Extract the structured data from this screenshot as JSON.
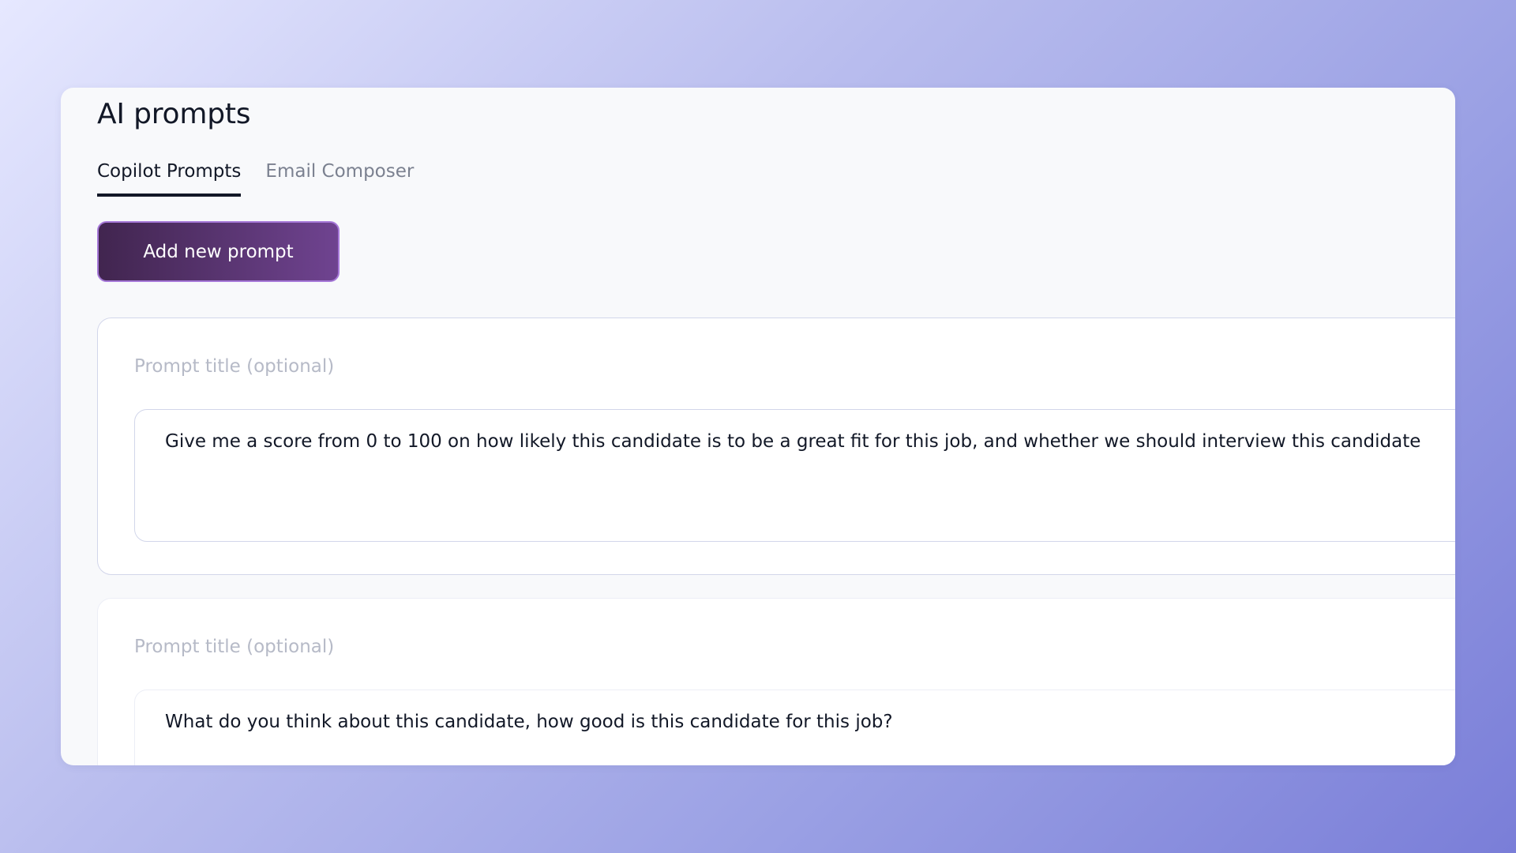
{
  "page": {
    "title": "AI prompts"
  },
  "tabs": [
    {
      "label": "Copilot Prompts",
      "active": true
    },
    {
      "label": "Email Composer",
      "active": false
    }
  ],
  "actions": {
    "add_prompt_label": "Add new prompt"
  },
  "prompts": [
    {
      "title_value": "",
      "title_placeholder": "Prompt title (optional)",
      "body": "Give me a score from 0 to 100 on how likely this candidate is to be a great fit for this job, and whether we should interview this candidate"
    },
    {
      "title_value": "",
      "title_placeholder": "Prompt title (optional)",
      "body": "What do you think about this candidate, how good is this candidate for this job?"
    }
  ],
  "colors": {
    "accent_start": "#41254f",
    "accent_end": "#6f4390",
    "accent_border": "#a678d8",
    "text_primary": "#121827",
    "text_muted": "#7b8190"
  }
}
